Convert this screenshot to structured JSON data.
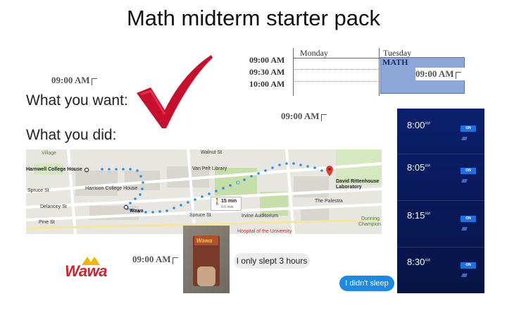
{
  "title": "Math midterm starter pack",
  "stamps": {
    "left_top": "09:00 AM",
    "center": "09:00 AM",
    "bottom": "09:00 AM",
    "calendar": "09:00 AM"
  },
  "captions": {
    "want": "What you want:",
    "did": "What you did:"
  },
  "calendar": {
    "times": [
      "09:00 AM",
      "09:30 AM",
      "10:00 AM"
    ],
    "days": [
      "Monday",
      "Tuesday"
    ],
    "event_label": "MATH"
  },
  "map": {
    "labels": {
      "walnut": "Walnut St",
      "village": "Village",
      "van_pelt": "Van Pelt Library",
      "harnwell": "Harnwell College House",
      "harrison": "Harrison College House",
      "spruce_left": "Spruce St",
      "delancey": "Delancey St",
      "pine": "Pine St",
      "wawa": "Wawa",
      "spruce_mid": "Spruce St",
      "duration": "15 min",
      "distance": "0.6 mile",
      "drl_1": "David Rittenhouse",
      "drl_2": "Laboratory",
      "palestra": "The Palestra",
      "irvine": "Irvine Auditorium",
      "hospital": "Hospital of the University",
      "dunning_1": "Dunning",
      "dunning_2": "Champion"
    }
  },
  "alarms": [
    {
      "time": "8:00",
      "ampm": "AM",
      "toggle": "ON"
    },
    {
      "time": "8:05",
      "ampm": "AM",
      "toggle": "ON"
    },
    {
      "time": "8:15",
      "ampm": "AM",
      "toggle": "ON"
    },
    {
      "time": "8:30",
      "ampm": "AM",
      "toggle": "ON"
    }
  ],
  "chat": {
    "incoming": "I only slept 3 hours",
    "outgoing": "I didn't sleep"
  },
  "logo": {
    "text": "Wawa",
    "cup_text": "Wawa"
  },
  "colors": {
    "check_red": "#c8102e",
    "route_blue": "#2b8fe6",
    "alarm_bg": "#0b1f6e",
    "toggle_blue": "#1e6fe0",
    "bubble_blue": "#1e88e5",
    "wawa_red": "#d2232a",
    "wawa_gold": "#f5b400"
  }
}
